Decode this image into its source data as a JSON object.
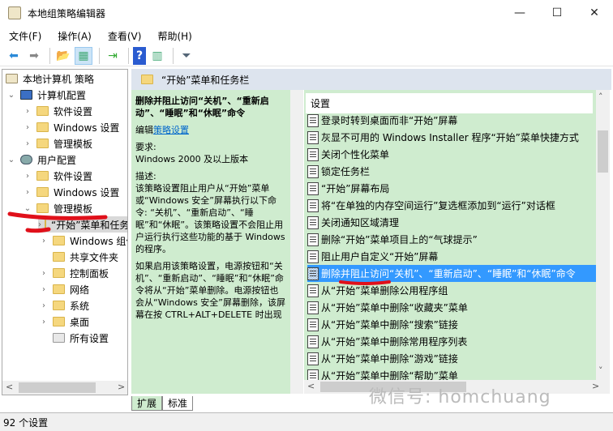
{
  "window": {
    "title": "本地组策略编辑器",
    "minimize": "—",
    "maximize": "☐",
    "close": "✕"
  },
  "menu": [
    "文件(F)",
    "操作(A)",
    "查看(V)",
    "帮助(H)"
  ],
  "toolbar": {
    "icons": [
      "back-arrow-icon",
      "forward-arrow-icon",
      "up-folder-icon",
      "show-hide-tree-icon",
      "export-list-icon",
      "help-icon",
      "action-pane-icon",
      "filter-icon"
    ],
    "glyphs": [
      "⬅",
      "➡",
      "📂",
      "▦",
      "⇥",
      "?",
      "▥",
      "⏷"
    ]
  },
  "tree": {
    "root": "本地计算机 策略",
    "computer_config": "计算机配置",
    "cc_software": "软件设置",
    "cc_windows": "Windows 设置",
    "cc_admin": "管理模板",
    "user_config": "用户配置",
    "uc_software": "软件设置",
    "uc_windows": "Windows 设置",
    "uc_admin": "管理模板",
    "start_menu": "“开始”菜单和任务栏",
    "windows_components": "Windows 组件",
    "shared_folders": "共享文件夹",
    "control_panel": "控制面板",
    "network": "网络",
    "system": "系统",
    "desktop": "桌面",
    "all_settings": "所有设置"
  },
  "right": {
    "header": "“开始”菜单和任务栏",
    "desc": {
      "title": "删除并阻止访问“关机”、“重新启动”、“睡眠”和“休眠”命令",
      "edit_prefix": "编辑",
      "edit_link": "策略设置",
      "req_label": "要求:",
      "req_value": "Windows 2000 及以上版本",
      "desc_label": "描述:",
      "desc_text": "该策略设置阻止用户从“开始”菜单或“Windows 安全”屏幕执行以下命令: “关机”、“重新启动”、“睡眠”和“休眠”。该策略设置不会阻止用户运行执行这些功能的基于 Windows 的程序。",
      "desc_text2": "如果启用该策略设置，电源按钮和“关机”、“重新启动”、“睡眠”和“休眠”命令将从“开始”菜单删除。电源按钮也会从“Windows 安全”屏幕删除，该屏幕在按 CTRL+ALT+DELETE 时出现"
    },
    "list_header": "设置",
    "items": [
      "登录时转到桌面而非“开始”屏幕",
      "灰显不可用的 Windows Installer 程序“开始”菜单快捷方式",
      "关闭个性化菜单",
      "锁定任务栏",
      "“开始”屏幕布局",
      "将“在单独的内存空间运行”复选框添加到“运行”对话框",
      "关闭通知区域清理",
      "删除“开始”菜单项目上的“气球提示”",
      "阻止用户自定义“开始”屏幕",
      "删除并阻止访问“关机”、“重新启动”、“睡眠”和“休眠”命令",
      "从“开始”菜单删除公用程序组",
      "从“开始”菜单中删除“收藏夹”菜单",
      "从“开始”菜单中删除“搜索”链接",
      "从“开始”菜单中删除常用程序列表",
      "从“开始”菜单中删除“游戏”链接",
      "从“开始”菜单中删除“帮助”菜单"
    ],
    "selected_index": 9,
    "tabs": [
      "扩展",
      "标准"
    ]
  },
  "status": "92 个设置",
  "watermark": "微信号: homchuang",
  "colors": {
    "green": "#cfeccf",
    "selection": "#3399ff",
    "annotation": "#e0101a"
  }
}
